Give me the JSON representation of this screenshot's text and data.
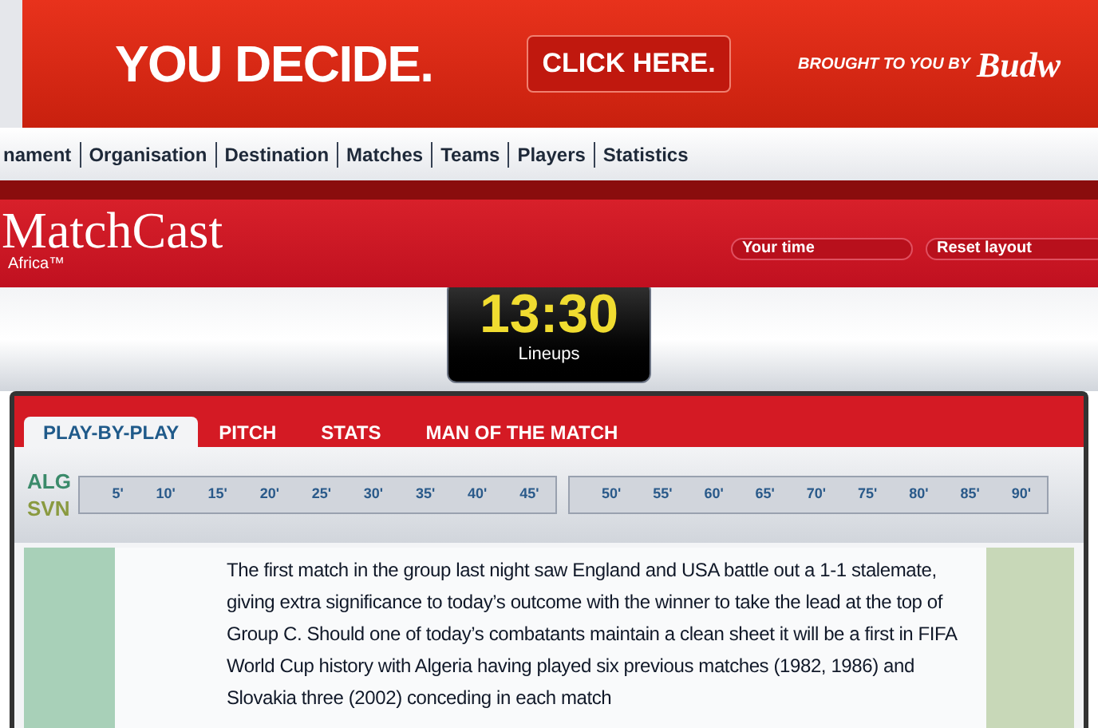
{
  "ad_banner": {
    "headline": "YOU DECIDE.",
    "button": "CLICK HERE.",
    "sponsor_line": "BROUGHT TO YOU BY",
    "sponsor_logo": "Budw"
  },
  "nav": {
    "items": [
      "nament",
      "Organisation",
      "Destination",
      "Matches",
      "Teams",
      "Players",
      "Statistics"
    ]
  },
  "header": {
    "logo": "MatchCast",
    "sub": "Africa™",
    "buttons": [
      "Your time",
      "Reset layout"
    ]
  },
  "clock": {
    "time": "13:30",
    "phase": "Lineups"
  },
  "tabs": [
    {
      "label": "PLAY-BY-PLAY",
      "selected": true
    },
    {
      "label": "PITCH",
      "selected": false
    },
    {
      "label": "STATS",
      "selected": false
    },
    {
      "label": "MAN OF THE MATCH",
      "selected": false
    }
  ],
  "timeline": {
    "teams": [
      "ALG",
      "SVN"
    ],
    "first_half": [
      "5'",
      "10'",
      "15'",
      "20'",
      "25'",
      "30'",
      "35'",
      "40'",
      "45'"
    ],
    "second_half": [
      "50'",
      "55'",
      "60'",
      "65'",
      "70'",
      "75'",
      "80'",
      "85'",
      "90'"
    ]
  },
  "commentary": "The first match in the group last night saw England and USA battle out a 1-1 stalemate, giving extra significance to today’s outcome with the winner to take the lead at the top of Group C. Should one of today’s combatants maintain a clean sheet it will be a first in FIFA World Cup history with Algeria having played six previous matches (1982, 1986) and Slovakia three (2002) conceding in each match"
}
